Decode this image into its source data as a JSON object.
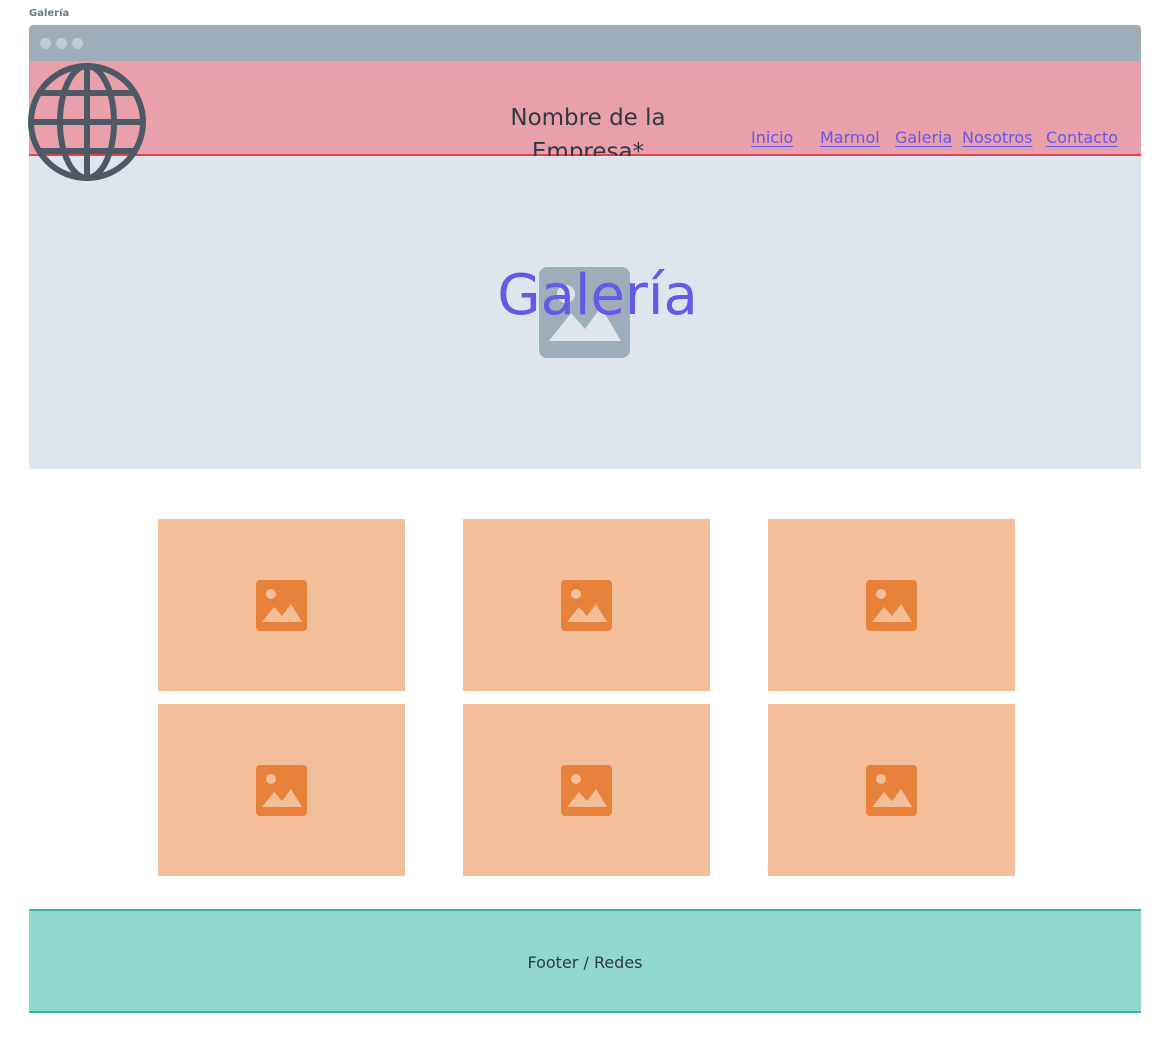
{
  "frame_label": "Galería",
  "header": {
    "company_name_line1": "Nombre de la",
    "company_name_line2": "Empresa*",
    "nav": [
      "Inicio",
      "Marmol",
      "Galeria",
      "Nosotros",
      "Contacto"
    ]
  },
  "hero": {
    "title": "Galería",
    "icon": "image-placeholder-icon"
  },
  "gallery": {
    "tile_count": 6,
    "icon": "image-icon"
  },
  "footer": {
    "text": "Footer / Redes"
  },
  "colors": {
    "header_bg": "#e9a0aa",
    "header_border": "#e0454f",
    "hero_bg": "#dfe5ed",
    "accent": "#6658e8",
    "tile_bg": "#f3bf9b",
    "tile_icon": "#e8823a",
    "footer_bg": "#90d8cd"
  }
}
